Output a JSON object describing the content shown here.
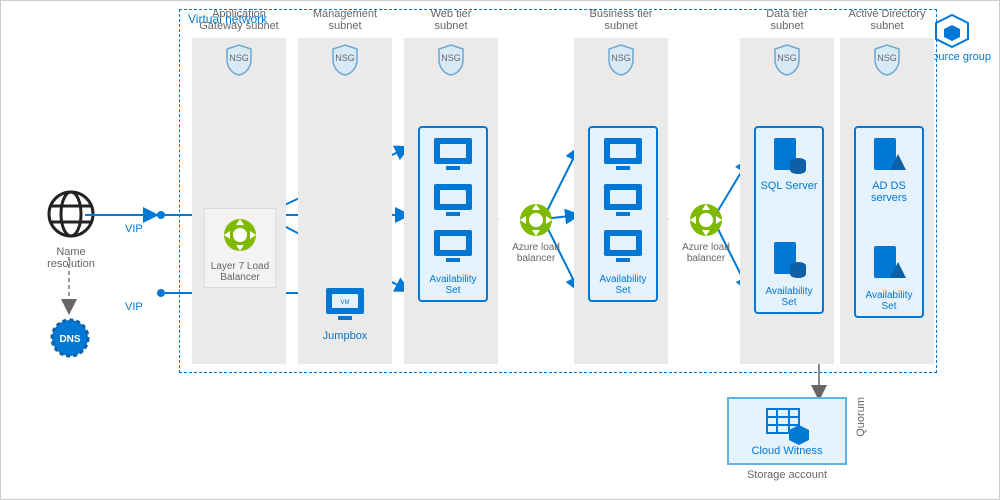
{
  "vnet_label": "Virtual network",
  "resource_group": "Resource group",
  "nsg_label": "NSG",
  "name_resolution": "Name resolution",
  "dns_label": "DNS",
  "vip_label": "VIP",
  "availability_set": "Availability\nSet",
  "subnets": {
    "app_gateway": "Application\nGateway subnet",
    "management": "Management\nsubnet",
    "web": "Web tier\nsubnet",
    "business": "Business tier\nsubnet",
    "data": "Data tier\nsubnet",
    "ad": "Active Directory\nsubnet"
  },
  "components": {
    "layer7_lb": "Layer 7 Load\nBalancer",
    "jumpbox": "Jumpbox",
    "azure_lb": "Azure load\nbalancer",
    "sql_server": "SQL Server",
    "ad_ds": "AD DS\nservers",
    "cloud_witness": "Cloud Witness",
    "storage_account": "Storage account"
  },
  "quorum": "Quorum"
}
